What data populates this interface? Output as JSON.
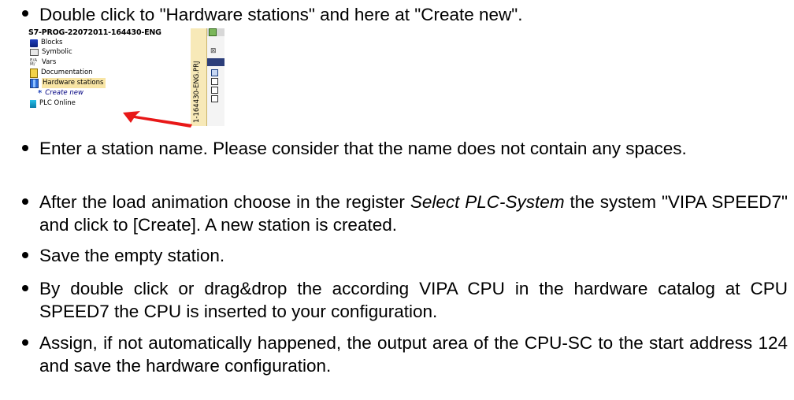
{
  "steps": [
    {
      "text": "Double click to \"Hardware stations\" and here at \"Create new\"."
    },
    {
      "text": "Enter a station name. Please consider that the name does not contain any spaces."
    },
    {
      "pre": "After the load animation choose in the register ",
      "em": "Select PLC-System",
      "post": " the system \"VIPA SPEED7\" and click to [Create]. A new station is created."
    },
    {
      "text": "Save the empty station."
    },
    {
      "text": "By double click or drag&drop the according VIPA CPU in the hardware catalog at CPU SPEED7 the CPU is inserted to your configuration."
    },
    {
      "text": "Assign, if not automatically happened, the output area of the CPU-SC to the start address 124 and save the hardware configuration."
    }
  ],
  "screenshot": {
    "project_title": "S7-PROG-22072011-164430-ENG",
    "items": [
      {
        "label": "Blocks",
        "icon": "blocks-icon"
      },
      {
        "label": "Symbolic",
        "icon": "symbolic-icon"
      },
      {
        "label": "Vars",
        "icon": "vars-icon"
      },
      {
        "label": "Documentation",
        "icon": "documentation-icon"
      },
      {
        "label": "Hardware stations",
        "icon": "hardware-stations-icon",
        "highlighted": true
      },
      {
        "label": "Create new",
        "icon": "create-new-star-icon"
      },
      {
        "label": "PLC Online",
        "icon": "plc-online-icon"
      }
    ],
    "vars_icon_text": "E/A\nM/",
    "star_glyph": "*",
    "side_panel_label": "1-164430-ENG.PRJ",
    "close_glyph": "⊠",
    "highlight_color": "#f8e5a5",
    "arrow_color": "#e81818"
  }
}
